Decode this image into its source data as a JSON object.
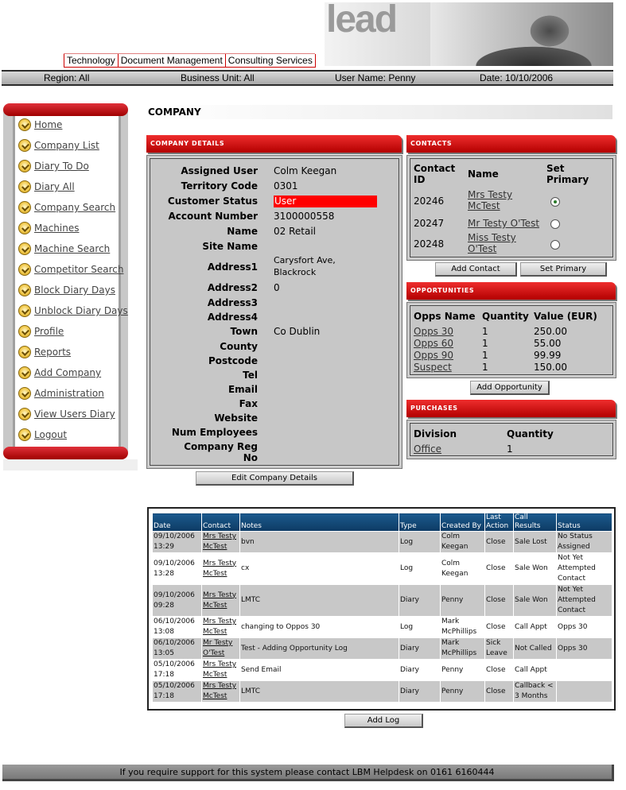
{
  "header": {
    "logo_text": "lead",
    "tabs": [
      "Technology",
      "Document Management",
      "Consulting Services"
    ]
  },
  "infobar": {
    "region": "Region: All",
    "business_unit": "Business Unit: All",
    "user_name": "User Name: Penny",
    "date": "Date: 10/10/2006"
  },
  "nav": {
    "items": [
      {
        "label": "Home",
        "icon": "nav-bullet-icon"
      },
      {
        "label": "Company List",
        "icon": "nav-bullet-icon"
      },
      {
        "label": "Diary To Do",
        "icon": "nav-bullet-icon"
      },
      {
        "label": "Diary All",
        "icon": "nav-bullet-icon"
      },
      {
        "label": "Company Search",
        "icon": "nav-bullet-icon"
      },
      {
        "label": "Machines",
        "icon": "nav-bullet-icon"
      },
      {
        "label": "Machine Search",
        "icon": "nav-bullet-icon"
      },
      {
        "label": "Competitor Search",
        "icon": "nav-bullet-icon"
      },
      {
        "label": "Block Diary Days",
        "icon": "nav-bullet-icon"
      },
      {
        "label": "Unblock Diary Days",
        "icon": "nav-bullet-icon"
      },
      {
        "label": "Profile",
        "icon": "nav-bullet-icon"
      },
      {
        "label": "Reports",
        "icon": "nav-bullet-icon"
      },
      {
        "label": "Add Company",
        "icon": "nav-bullet-icon"
      },
      {
        "label": "Administration",
        "icon": "nav-bullet-icon"
      },
      {
        "label": "View Users Diary",
        "icon": "nav-bullet-icon"
      },
      {
        "label": "Logout",
        "icon": "nav-bullet-icon"
      }
    ]
  },
  "page_title": "COMPANY",
  "company_details": {
    "header": "COMPANY DETAILS",
    "fields": [
      {
        "label": "Assigned User",
        "value": "Colm Keegan"
      },
      {
        "label": "Territory Code",
        "value": "0301"
      },
      {
        "label": "Customer Status",
        "value": "User"
      },
      {
        "label": "Account Number",
        "value": "3100000558"
      },
      {
        "label": "Name",
        "value": "02 Retail"
      },
      {
        "label": "Site Name",
        "value": ""
      },
      {
        "label": "Address1",
        "value": "Carysfort Ave,",
        "value2": "Blackrock"
      },
      {
        "label": "Address2",
        "value": "0"
      },
      {
        "label": "Address3",
        "value": ""
      },
      {
        "label": "Address4",
        "value": ""
      },
      {
        "label": "Town",
        "value": "Co Dublin"
      },
      {
        "label": "County",
        "value": ""
      },
      {
        "label": "Postcode",
        "value": ""
      },
      {
        "label": "Tel",
        "value": ""
      },
      {
        "label": "Email",
        "value": ""
      },
      {
        "label": "Fax",
        "value": ""
      },
      {
        "label": "Website",
        "value": ""
      },
      {
        "label": "Num Employees",
        "value": ""
      },
      {
        "label": "Company Reg",
        "label2": "No",
        "value": ""
      }
    ],
    "edit_button": "Edit Company Details",
    "status_color": "#ff0000"
  },
  "contacts": {
    "header": "CONTACTS",
    "col_id_1": "Contact",
    "col_id_2": "ID",
    "col_name": "Name",
    "col_primary_1": "Set",
    "col_primary_2": "Primary",
    "rows": [
      {
        "id": "20246",
        "name1": "Mrs Testy",
        "name2": "McTest",
        "primary": true
      },
      {
        "id": "20247",
        "name1": "Mr Testy O'Test",
        "name2": "",
        "primary": false
      },
      {
        "id": "20248",
        "name1": "Miss Testy",
        "name2": "O'Test",
        "primary": false
      }
    ],
    "add_button": "Add Contact",
    "set_primary_button": "Set Primary"
  },
  "opportunities": {
    "header": "OPPORTUNITIES",
    "columns": [
      "Opps Name",
      "Quantity",
      "Value (EUR)"
    ],
    "rows": [
      {
        "name": "Opps 30",
        "qty": "1",
        "value": "250.00"
      },
      {
        "name": "Opps 60",
        "qty": "1",
        "value": "55.00"
      },
      {
        "name": "Opps 90",
        "qty": "1",
        "value": "99.99"
      },
      {
        "name": "Suspect",
        "qty": "1",
        "value": "150.00"
      }
    ],
    "add_button": "Add Opportunity"
  },
  "purchases": {
    "header": "PURCHASES",
    "columns": [
      "Division",
      "Quantity"
    ],
    "rows": [
      {
        "division": "Office",
        "qty": "1"
      }
    ]
  },
  "log": {
    "columns": [
      "Date",
      "Contact",
      "Notes",
      "Type",
      "Created By",
      "Last Action",
      "Call Results",
      "Status"
    ],
    "rows": [
      {
        "date": "09/10/2006 13:29",
        "contact": "Mrs Testy McTest",
        "notes": "bvn",
        "type": "Log",
        "created": "Colm Keegan",
        "last": "Close",
        "result": "Sale Lost",
        "status": "No Status Assigned"
      },
      {
        "date": "09/10/2006 13:28",
        "contact": "Mrs Testy McTest",
        "notes": "cx",
        "type": "Log",
        "created": "Colm Keegan",
        "last": "Close",
        "result": "Sale Won",
        "status": "Not Yet Attempted Contact"
      },
      {
        "date": "09/10/2006 09:28",
        "contact": "Mrs Testy McTest",
        "notes": "LMTC",
        "type": "Diary",
        "created": "Penny",
        "last": "Close",
        "result": "Sale Won",
        "status": "Not Yet Attempted Contact"
      },
      {
        "date": "06/10/2006 13:08",
        "contact": "Mrs Testy McTest",
        "notes": "changing to Oppos 30",
        "type": "Log",
        "created": "Mark McPhillips",
        "last": "Close",
        "result": "Call Appt",
        "status": "Opps 30"
      },
      {
        "date": "06/10/2006 13:05",
        "contact": "Mr Testy O'Test",
        "notes": "Test - Adding Opportunity Log",
        "type": "Diary",
        "created": "Mark McPhillips",
        "last": "Sick Leave",
        "result": "Not Called",
        "status": "Opps 30"
      },
      {
        "date": "05/10/2006 17:18",
        "contact": "Mrs Testy McTest",
        "notes": "Send Email",
        "type": "Diary",
        "created": "Penny",
        "last": "Close",
        "result": "Call Appt",
        "status": ""
      },
      {
        "date": "05/10/2006 17:18",
        "contact": "Mrs Testy McTest",
        "notes": "LMTC",
        "type": "Diary",
        "created": "Penny",
        "last": "Close",
        "result": "Callback < 3 Months",
        "status": ""
      }
    ],
    "add_button": "Add Log",
    "header_color": "#1b5a8e"
  },
  "footer": {
    "text": "If you require support for this system please contact LBM Helpdesk on 0161 6160444"
  }
}
